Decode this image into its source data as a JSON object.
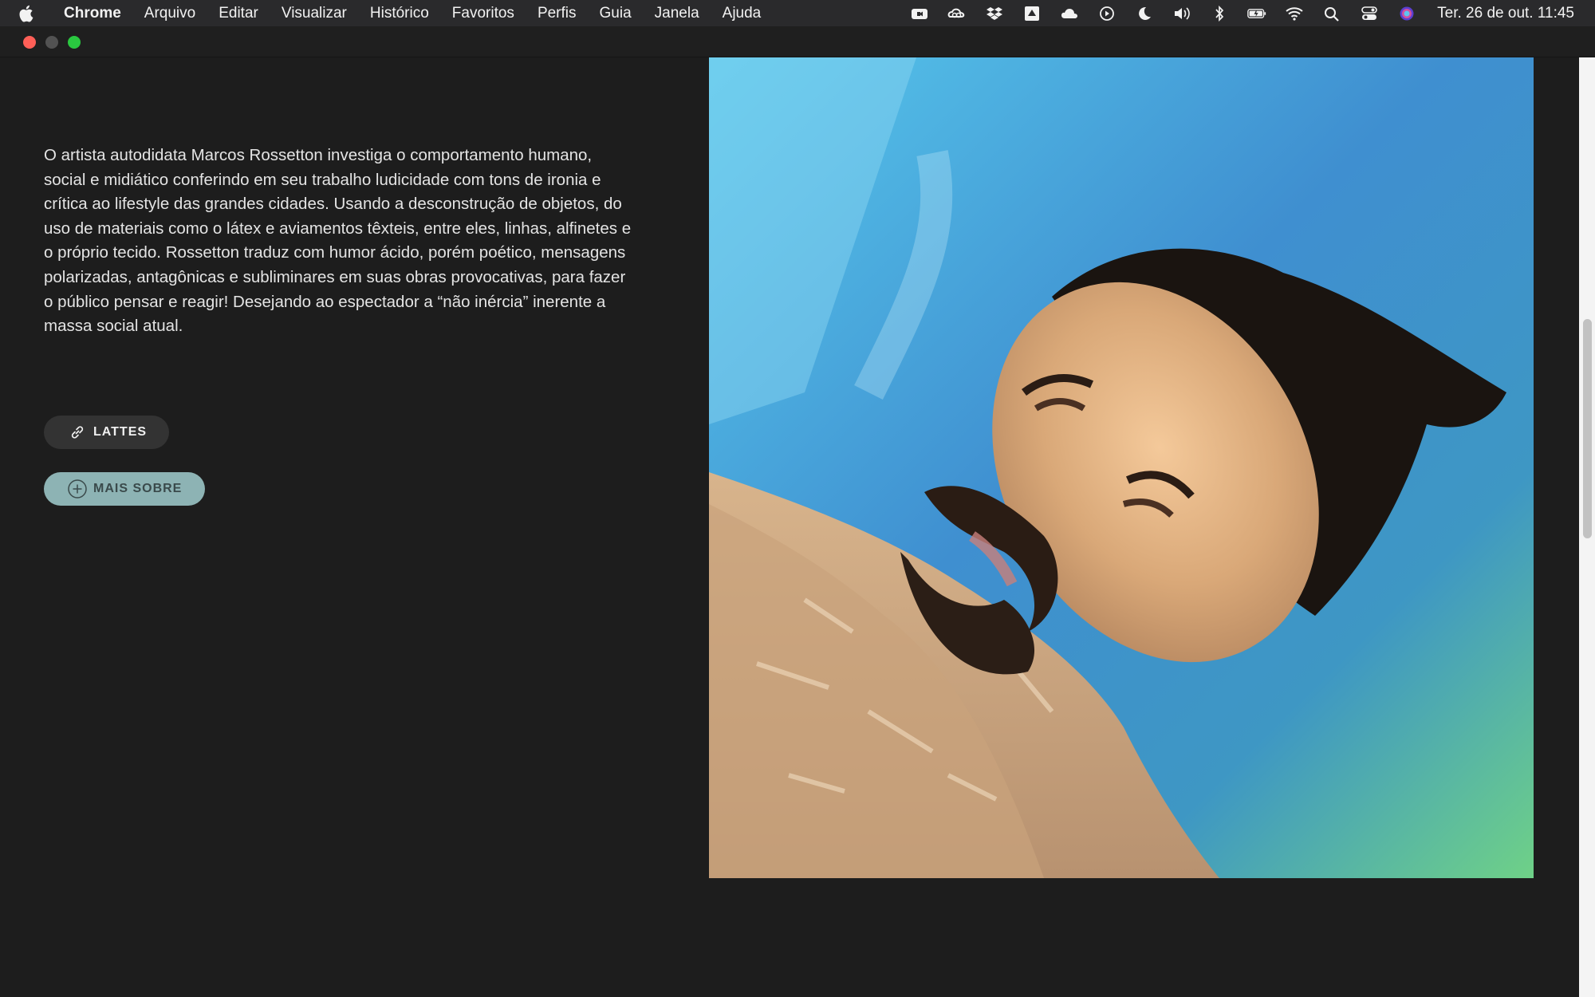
{
  "menubar": {
    "app_name": "Chrome",
    "menus": [
      "Arquivo",
      "Editar",
      "Visualizar",
      "Histórico",
      "Favoritos",
      "Perfis",
      "Guia",
      "Janela",
      "Ajuda"
    ],
    "status_icons": [
      "facetime-icon",
      "creative-cloud-icon",
      "dropbox-icon",
      "google-drive-icon",
      "icloud-icon",
      "play-icon",
      "moon-icon",
      "volume-icon",
      "bluetooth-icon",
      "battery-icon",
      "wifi-icon",
      "spotlight-icon",
      "control-center-icon",
      "siri-icon"
    ],
    "clock": "Ter. 26 de out.  11:45"
  },
  "page": {
    "bio": "O artista autodidata Marcos Rossetton investiga o comportamento humano, social e midiático conferindo em seu trabalho ludicidade com tons de ironia e crítica ao lifestyle das grandes cidades. Usando a desconstrução de objetos, do uso de materiais como o látex e aviamentos têxteis, entre eles, linhas, alfinetes e o próprio tecido. Rossetton traduz com humor ácido, porém poético, mensagens polarizadas, antagônicas e subliminares em suas obras provocativas, para fazer o público pensar e reagir! Desejando ao espectador a “não inércia” inerente a massa social atual.",
    "buttons": {
      "lattes": "LATTES",
      "more": "MAIS SOBRE"
    },
    "photo_subject": "underwater-portrait"
  },
  "colors": {
    "background": "#1d1d1d",
    "text": "#e4e4e4",
    "lattes_button": "#333333",
    "more_button": "#8db3b4"
  }
}
